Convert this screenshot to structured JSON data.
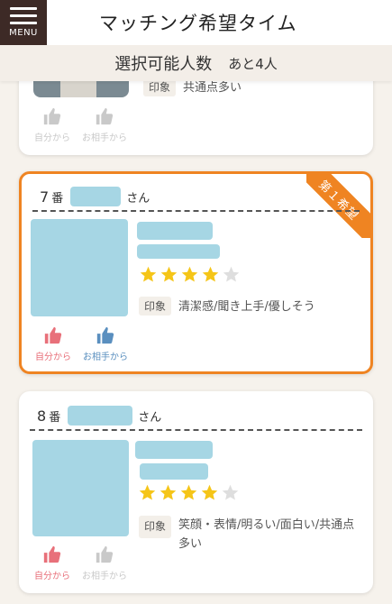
{
  "header": {
    "menu_label": "MENU",
    "title": "マッチング希望タイム"
  },
  "subheader": {
    "label": "選択可能人数",
    "remaining": "あと4人"
  },
  "cards": [
    {
      "impression_tag": "印象",
      "impression": "共通点多い",
      "like_self": "自分から",
      "like_other": "お相手から",
      "like_self_active": false,
      "like_other_active": false
    },
    {
      "number": "7",
      "ban": "番",
      "san": "さん",
      "rating": 4,
      "rating_max": 5,
      "impression_tag": "印象",
      "impression": "清潔感/聞き上手/優しそう",
      "like_self": "自分から",
      "like_other": "お相手から",
      "like_self_active": true,
      "like_other_active": true,
      "ribbon": "第１希望"
    },
    {
      "number": "8",
      "ban": "番",
      "san": "さん",
      "rating": 4,
      "rating_max": 5,
      "impression_tag": "印象",
      "impression": "笑顔・表情/明るい/面白い/共通点多い",
      "like_self": "自分から",
      "like_other": "お相手から",
      "like_self_active": true,
      "like_other_active": false
    }
  ],
  "colors": {
    "accent": "#ef8422",
    "placeholder": "#a6d6e4",
    "like_self": "#e8707a",
    "like_other": "#5a8fbf",
    "inactive": "#c9c9c9",
    "star": "#f5c518"
  },
  "icons": {
    "menu": "hamburger-icon",
    "like": "thumbs-up-icon",
    "star": "star-icon"
  }
}
